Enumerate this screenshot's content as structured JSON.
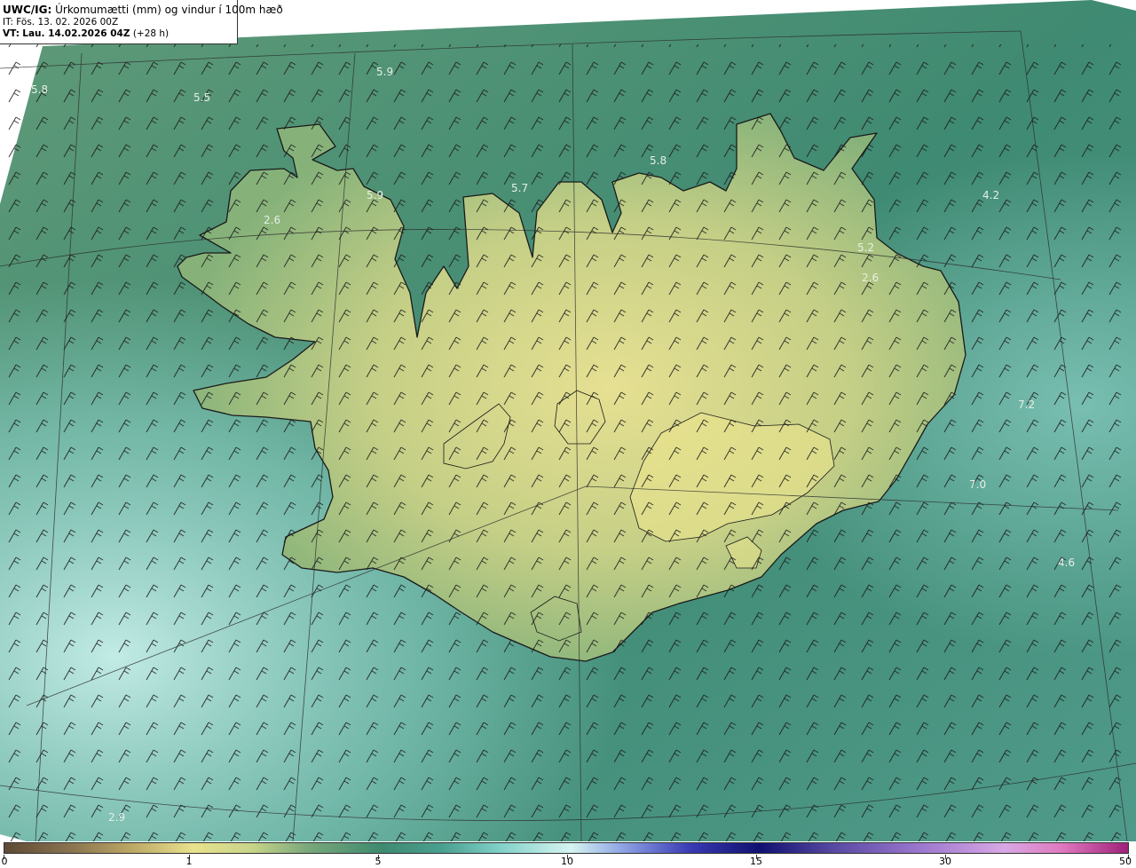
{
  "header": {
    "model": "UWC/IG:",
    "title": "Úrkomumætti (mm) og vindur í 100m hæð",
    "init_time": "IT: Fös. 13. 02. 2026 00Z",
    "valid_prefix": "VT:",
    "valid_time": "Lau. 14.02.2026 04Z",
    "lead": "(+28 h)"
  },
  "map": {
    "region": "Iceland",
    "coastline_color": "#1a1a1a",
    "wind_barb_color": "#1a1a1a",
    "value_labels": [
      "5.8",
      "5.5",
      "5.9",
      "5.9",
      "2.6",
      "5.7",
      "5.8",
      "4.2",
      "5.2",
      "2.6",
      "7.2",
      "7.0",
      "4.6",
      "2.9"
    ]
  },
  "colorbar": {
    "ticks": [
      "0",
      "1",
      "5",
      "10",
      "15",
      "30",
      "50"
    ],
    "colors": {
      "low": "#5e4a36",
      "one": "#e9e28c",
      "five": "#3e8a70",
      "ten": "#d6f4f0",
      "fifteen": "#101070",
      "high": "#a0207a"
    }
  }
}
